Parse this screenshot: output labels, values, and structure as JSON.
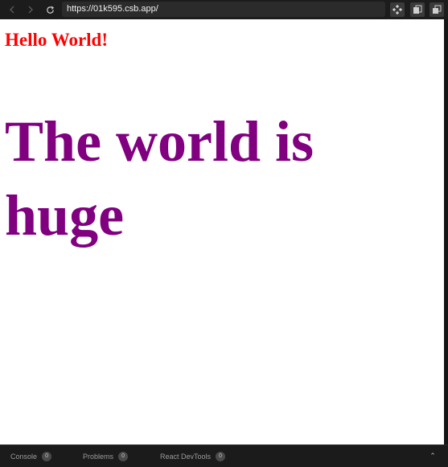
{
  "browser": {
    "url": "https://01k595.csb.app/",
    "icons": {
      "back": "arrow-left-icon",
      "forward": "arrow-right-icon",
      "reload": "reload-icon",
      "tool1": "diamond-grid-icon",
      "tool2": "copy-icon",
      "tool3": "open-window-icon"
    }
  },
  "page": {
    "heading_small": "Hello World!",
    "heading_large": "The world is huge",
    "colors": {
      "heading_small": "#ff0000",
      "heading_large": "#800080"
    }
  },
  "devtools": {
    "tabs": [
      {
        "label": "Console",
        "count": "0"
      },
      {
        "label": "Problems",
        "count": "0"
      },
      {
        "label": "React DevTools",
        "count": "0"
      }
    ],
    "expand_icon": "chevron-up-icon"
  }
}
